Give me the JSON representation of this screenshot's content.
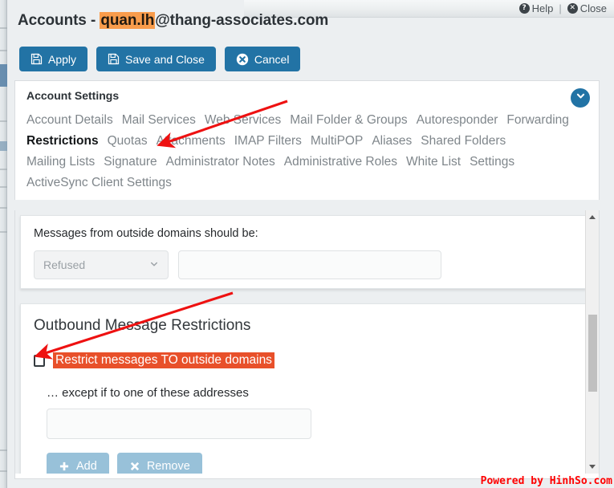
{
  "window": {
    "help_label": "Help",
    "close_label": "Close",
    "separator": "|",
    "help_icon": "question-circle-icon",
    "close_icon": "close-circle-icon"
  },
  "header": {
    "prefix": "Accounts - ",
    "highlight": "quan.lh",
    "suffix": "@thang-associates.com",
    "highlight_color": "#f99c4b"
  },
  "toolbar": {
    "buttons": [
      {
        "label": "Apply",
        "icon": "save-icon"
      },
      {
        "label": "Save and Close",
        "icon": "save-icon"
      },
      {
        "label": "Cancel",
        "icon": "cancel-circle-icon"
      }
    ],
    "button_color": "#2273a5"
  },
  "settings": {
    "title": "Account Settings",
    "collapse_icon": "chevron-down-icon",
    "tabs": [
      {
        "label": "Account Details",
        "active": false
      },
      {
        "label": "Mail Services",
        "active": false
      },
      {
        "label": "Web Services",
        "active": false
      },
      {
        "label": "Mail Folder & Groups",
        "active": false
      },
      {
        "label": "Autoresponder",
        "active": false
      },
      {
        "label": "Forwarding",
        "active": false
      },
      {
        "label": "Restrictions",
        "active": true
      },
      {
        "label": "Quotas",
        "active": false
      },
      {
        "label": "Attachments",
        "active": false
      },
      {
        "label": "IMAP Filters",
        "active": false
      },
      {
        "label": "MultiPOP",
        "active": false
      },
      {
        "label": "Aliases",
        "active": false
      },
      {
        "label": "Shared Folders",
        "active": false
      },
      {
        "label": "Mailing Lists",
        "active": false
      },
      {
        "label": "Signature",
        "active": false
      },
      {
        "label": "Administrator Notes",
        "active": false
      },
      {
        "label": "Administrative Roles",
        "active": false
      },
      {
        "label": "White List",
        "active": false
      },
      {
        "label": "Settings",
        "active": false
      },
      {
        "label": "ActiveSync Client Settings",
        "active": false
      }
    ]
  },
  "inbound": {
    "label": "Messages from outside domains should be:",
    "select_value": "Refused",
    "select_icon": "chevron-down-icon",
    "text_value": "",
    "text_placeholder": ""
  },
  "outbound": {
    "heading": "Outbound Message Restrictions",
    "restrict_label": "Restrict messages TO outside domains",
    "restrict_checked": false,
    "restrict_highlight_color": "#e8502a",
    "except_label": "… except if to one of these addresses",
    "address_value": "",
    "address_placeholder": "",
    "add_label": "Add",
    "add_icon": "plus-icon",
    "remove_label": "Remove",
    "remove_icon": "cross-icon",
    "button_color": "#98c1d9"
  },
  "scrollbar": {
    "up_icon": "triangle-up-icon",
    "down_icon": "triangle-down-icon"
  },
  "footer": {
    "watermark": "Powered by HinhSo.com",
    "watermark_color": "#ff0000"
  },
  "annotations": {
    "arrow_color": "#ee1111",
    "arrow_tabs_target": "Restrictions",
    "arrow_checkbox_target": "Restrict messages TO outside domains"
  }
}
